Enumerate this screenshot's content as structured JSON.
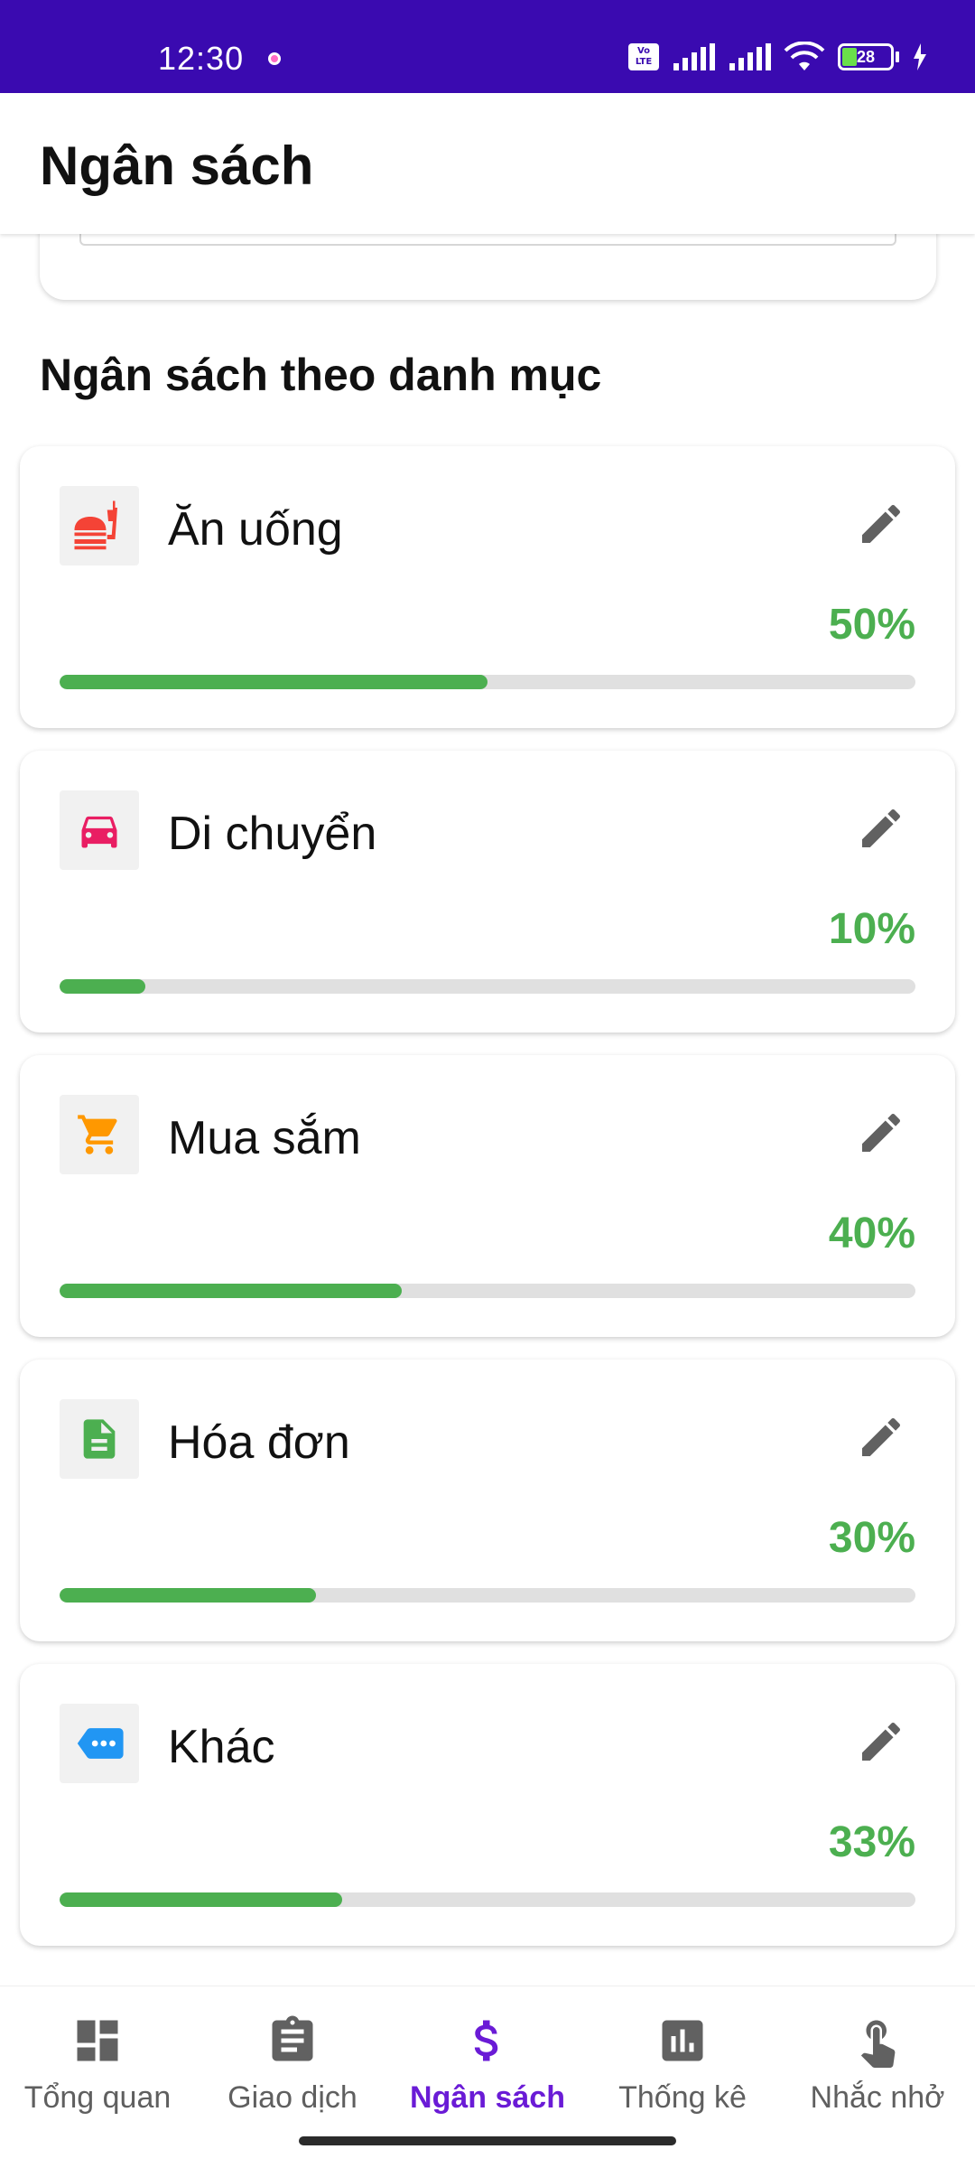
{
  "status_bar": {
    "time": "12:30",
    "battery_level": "28"
  },
  "app_bar": {
    "title": "Ngân sách"
  },
  "section": {
    "title": "Ngân sách theo danh mục"
  },
  "categories": [
    {
      "name": "Ăn uống",
      "percent_label": "50%",
      "percent": 50,
      "icon": "fastfood-icon",
      "icon_color": "#f44336"
    },
    {
      "name": "Di chuyển",
      "percent_label": "10%",
      "percent": 10,
      "icon": "car-icon",
      "icon_color": "#e91e63"
    },
    {
      "name": "Mua sắm",
      "percent_label": "40%",
      "percent": 40,
      "icon": "shopping-cart-icon",
      "icon_color": "#ff9800"
    },
    {
      "name": "Hóa đơn",
      "percent_label": "30%",
      "percent": 30,
      "icon": "bill-icon",
      "icon_color": "#4caf50"
    },
    {
      "name": "Khác",
      "percent_label": "33%",
      "percent": 33,
      "icon": "label-more-icon",
      "icon_color": "#2196f3"
    }
  ],
  "colors": {
    "progress": "#4caf50",
    "status_bar": "#3a0ab0",
    "active_nav": "#6a1bd6"
  },
  "bottom_nav": [
    {
      "label": "Tổng quan",
      "icon": "dashboard-icon",
      "active": false
    },
    {
      "label": "Giao dịch",
      "icon": "clipboard-icon",
      "active": false
    },
    {
      "label": "Ngân sách",
      "icon": "dollar-icon",
      "active": true
    },
    {
      "label": "Thống kê",
      "icon": "bar-chart-icon",
      "active": false
    },
    {
      "label": "Nhắc nhở",
      "icon": "touch-icon",
      "active": false
    }
  ]
}
